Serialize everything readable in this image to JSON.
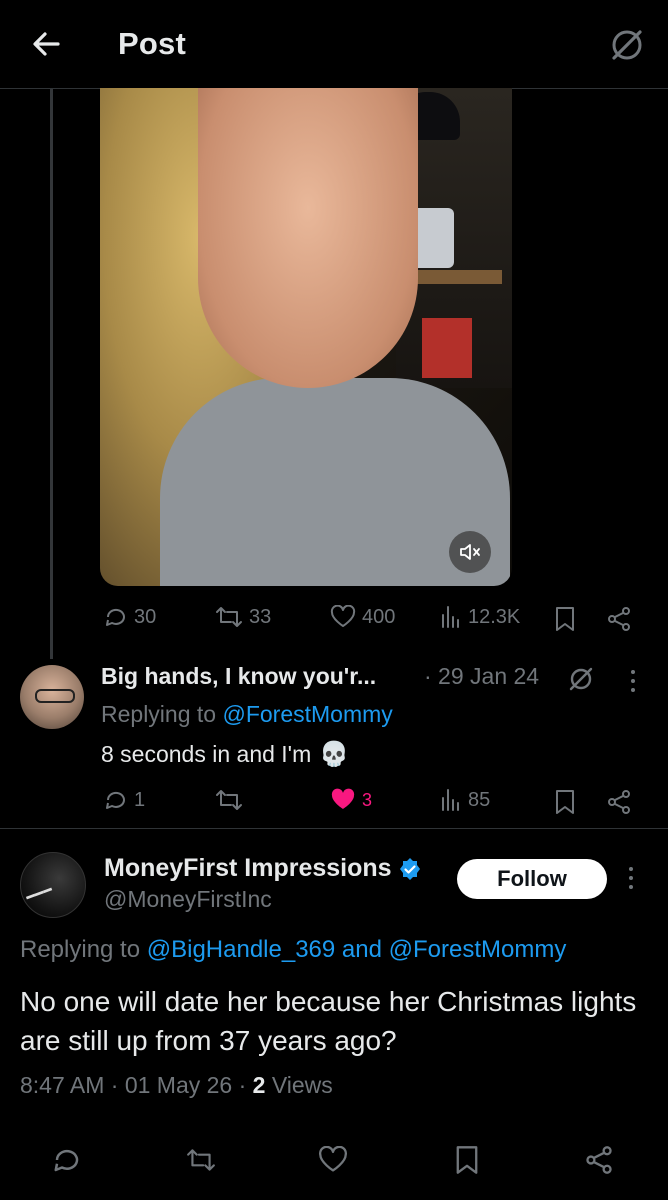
{
  "header": {
    "title": "Post",
    "back_icon": "arrow-left-icon",
    "grok_icon": "grok-icon"
  },
  "video_stats": {
    "replies": "30",
    "reposts": "33",
    "likes": "400",
    "views": "12.3K"
  },
  "reply": {
    "display_name": "Big hands, I know you'r...",
    "date": "· 29 Jan 24",
    "replying_prefix": "Replying to",
    "replying_handle": "@ForestMommy",
    "text": "8 seconds in and I'm",
    "emoji": "💀",
    "stats": {
      "replies": "1",
      "reposts": "",
      "likes": "3",
      "views": "85"
    },
    "like_color": "#f91880"
  },
  "post": {
    "display_name": "MoneyFirst Impressions",
    "handle": "@MoneyFirstInc",
    "follow_label": "Follow",
    "replying_prefix": "Replying to",
    "replying_handle_1": "@BigHandle_369",
    "replying_and": "and",
    "replying_handle_2": "@ForestMommy",
    "text": "No one will date her because her Christmas lights are still up from 37 years ago?",
    "time": "8:47 AM",
    "date": "· 01 May 26 ·",
    "views_count": "2",
    "views_label": "Views"
  },
  "colors": {
    "accent": "#1d9bf0",
    "muted": "#71767b",
    "like": "#f91880",
    "background": "#000000"
  }
}
